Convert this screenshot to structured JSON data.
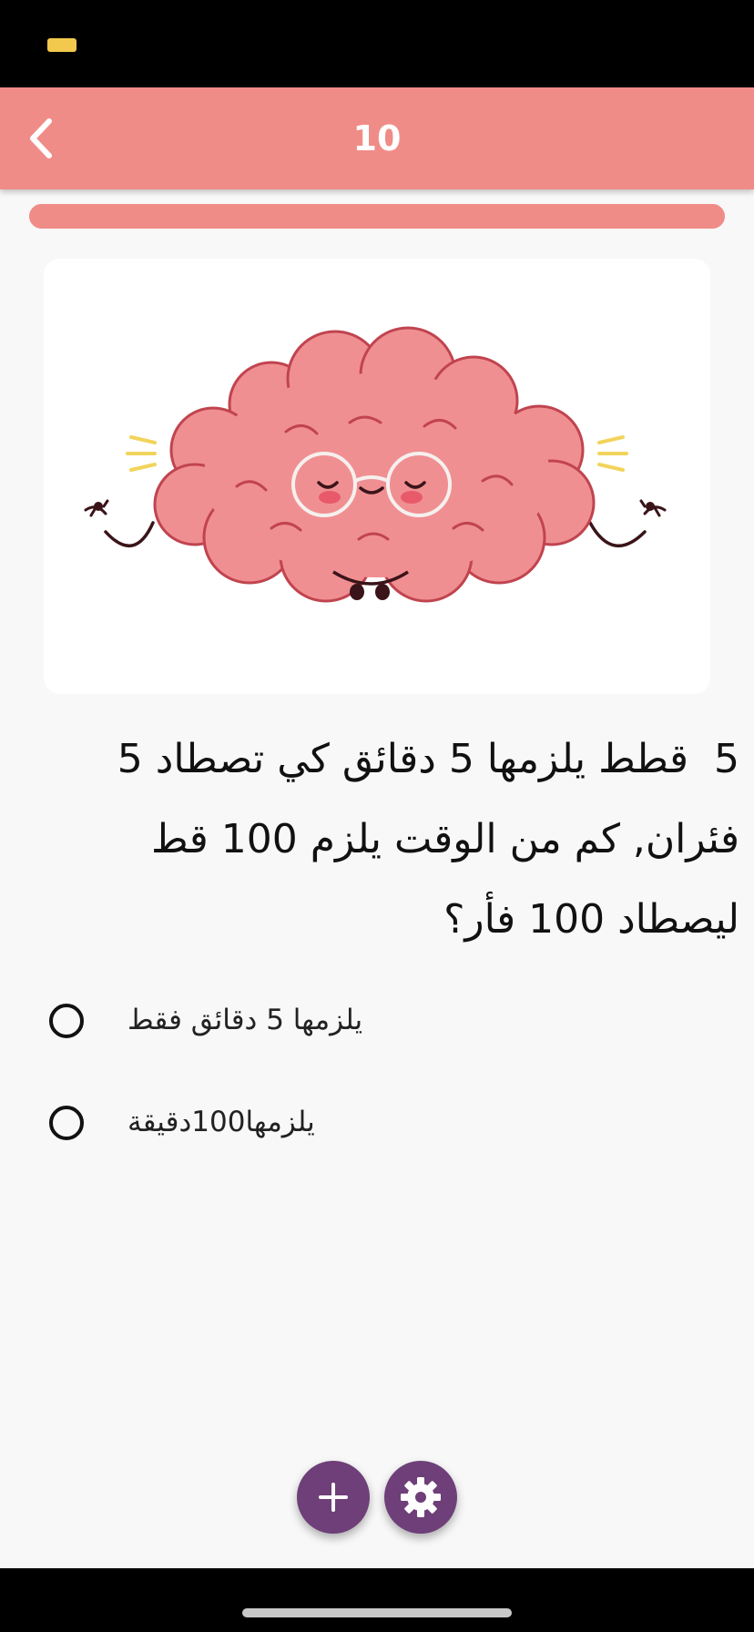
{
  "colors": {
    "app_bar": "#f08c88",
    "progress": "#f08c88",
    "fab": "#6e3f78",
    "battery": "#f2c94c"
  },
  "status_bar": {
    "battery_icon": "battery-icon"
  },
  "header": {
    "back_icon": "chevron-left-icon",
    "title": "10"
  },
  "progress": {
    "fraction": 1.0
  },
  "question_image": {
    "subject": "cartoon-brain-with-glasses-meditating"
  },
  "question": {
    "text": "5  قطط يلزمها 5 دقائق كي تصطاد 5 فئران, كم من الوقت يلزم 100 قط ليصطاد 100 فأر؟"
  },
  "options": [
    {
      "label": "يلزمها 5 دقائق فقط",
      "selected": false
    },
    {
      "label": "يلزمها100دقيقة",
      "selected": false
    }
  ],
  "fabs": {
    "add_icon": "plus-icon",
    "settings_icon": "gear-icon"
  }
}
